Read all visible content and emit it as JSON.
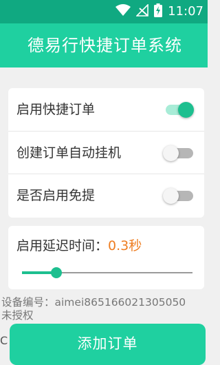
{
  "status_bar": {
    "time": "11:07",
    "icons": [
      "wifi-icon",
      "signal-blocked-icon",
      "battery-charging-icon"
    ]
  },
  "app_bar": {
    "title": "德易行快捷订单系统"
  },
  "settings": {
    "toggles": [
      {
        "label": "启用快捷订单",
        "on": true
      },
      {
        "label": "创建订单自动挂机",
        "on": false
      },
      {
        "label": "是否启用免提",
        "on": false
      }
    ]
  },
  "delay": {
    "label": "启用延迟时间：",
    "value": "0.3秒",
    "slider_fraction": 0.2
  },
  "device": {
    "id_line": "设备编号：aimei865166021305050",
    "license_status": "未授权"
  },
  "add_button": {
    "label": "添加订单"
  },
  "edge_text": "C",
  "colors": {
    "status_bar": "#10a981",
    "app_bar": "#1fd0a0",
    "accent": "#1dbf8f",
    "delay_value": "#ee7d21",
    "background": "#f0f0f0"
  }
}
